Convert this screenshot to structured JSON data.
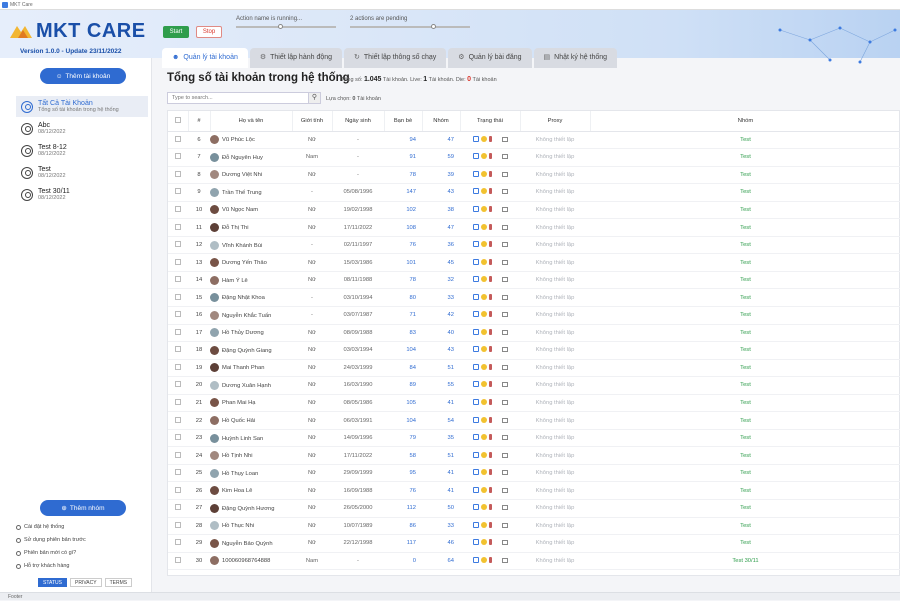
{
  "window": {
    "title": "MKT Care"
  },
  "brand": {
    "logo_text": "MKT CARE",
    "version": "Version 1.0.0 - Update 23/11/2022"
  },
  "controls": {
    "start_label": "Start",
    "stop_label": "Stop",
    "action_status": "Action name is running...",
    "pending_status": "2 actions are pending",
    "action_progress": 0.45,
    "pending_progress": 0.7
  },
  "tabs": [
    {
      "label": "Quản lý tài khoản",
      "icon": "users-icon",
      "active": true
    },
    {
      "label": "Thiết lập hành động",
      "icon": "gear-icon",
      "active": false
    },
    {
      "label": "Thiết lập thông số chạy",
      "icon": "refresh-icon",
      "active": false
    },
    {
      "label": "Quản lý bài đăng",
      "icon": "gear-icon",
      "active": false
    },
    {
      "label": "Nhật ký hệ thống",
      "icon": "log-icon",
      "active": false
    }
  ],
  "sidebar": {
    "add_account_label": "Thêm tài khoản",
    "accounts": [
      {
        "name": "Tất Cả Tài Khoản",
        "sub": "Tổng số tài khoản trong hệ thống",
        "selected": true
      },
      {
        "name": "Abc",
        "sub": "08/12/2022",
        "selected": false
      },
      {
        "name": "Test 8-12",
        "sub": "08/12/2022",
        "selected": false
      },
      {
        "name": "Test",
        "sub": "08/12/2022",
        "selected": false
      },
      {
        "name": "Test 30/11",
        "sub": "08/12/2022",
        "selected": false
      }
    ],
    "add_group_label": "Thêm nhóm",
    "links": [
      "Cài đặt hệ thống",
      "Sử dụng phiên bản trước",
      "Phiên bản mới có gì?",
      "Hỗ trợ khách hàng"
    ],
    "footer_buttons": [
      "STATUS",
      "PRIVACY",
      "TERMS"
    ]
  },
  "main": {
    "title": "Tổng số tài khoản trong hệ thống",
    "summary": {
      "total_label": "Tổng số:",
      "total": "1.045",
      "total_unit": "Tài khoản.",
      "live_label": "Live:",
      "live": "1",
      "live_unit": "Tài khoản.",
      "die_label": "Die:",
      "die": "0",
      "die_unit": "Tài khoản"
    },
    "search_placeholder": "Type to search...",
    "selection_label": "Lựa chọn:",
    "selection_count": "0",
    "selection_unit": "Tài khoản",
    "columns": [
      "#",
      "Họ và tên",
      "Giới tính",
      "Ngày sinh",
      "Bạn bè",
      "Nhóm",
      "Trạng thái",
      "Proxy",
      "Nhóm"
    ],
    "rows": [
      [
        "6",
        "Vũ Phúc Lộc",
        "Nữ",
        "-",
        "94",
        "47",
        "Không thiết lập",
        "Test"
      ],
      [
        "7",
        "Đỗ Nguyên Huy",
        "Nam",
        "-",
        "91",
        "59",
        "Không thiết lập",
        "Test"
      ],
      [
        "8",
        "Dương Việt Nhi",
        "Nữ",
        "-",
        "78",
        "39",
        "Không thiết lập",
        "Test"
      ],
      [
        "9",
        "Trần Thế Trung",
        "-",
        "05/08/1996",
        "147",
        "43",
        "Không thiết lập",
        "Test"
      ],
      [
        "10",
        "Vũ Ngọc Nam",
        "Nữ",
        "19/02/1998",
        "102",
        "38",
        "Không thiết lập",
        "Test"
      ],
      [
        "11",
        "Đỗ Thị Thi",
        "Nữ",
        "17/11/2022",
        "108",
        "47",
        "Không thiết lập",
        "Test"
      ],
      [
        "12",
        "Vĩnh Khánh Bùi",
        "-",
        "02/11/1997",
        "76",
        "36",
        "Không thiết lập",
        "Test"
      ],
      [
        "13",
        "Dương Yến Thảo",
        "Nữ",
        "15/03/1986",
        "101",
        "45",
        "Không thiết lập",
        "Test"
      ],
      [
        "14",
        "Hàm Ý Lê",
        "Nữ",
        "08/11/1988",
        "78",
        "32",
        "Không thiết lập",
        "Test"
      ],
      [
        "15",
        "Đặng Nhật Khoa",
        "-",
        "03/10/1994",
        "80",
        "33",
        "Không thiết lập",
        "Test"
      ],
      [
        "16",
        "Nguyễn Khắc Tuấn",
        "-",
        "03/07/1987",
        "71",
        "42",
        "Không thiết lập",
        "Test"
      ],
      [
        "17",
        "Hồ Thủy Dương",
        "Nữ",
        "08/09/1988",
        "83",
        "40",
        "Không thiết lập",
        "Test"
      ],
      [
        "18",
        "Đặng Quỳnh Giang",
        "Nữ",
        "03/03/1994",
        "104",
        "43",
        "Không thiết lập",
        "Test"
      ],
      [
        "19",
        "Mai Thanh Phan",
        "Nữ",
        "24/03/1999",
        "84",
        "51",
        "Không thiết lập",
        "Test"
      ],
      [
        "20",
        "Dương Xuân Hạnh",
        "Nữ",
        "16/03/1990",
        "89",
        "55",
        "Không thiết lập",
        "Test"
      ],
      [
        "21",
        "Phan Mai Hạ",
        "Nữ",
        "08/05/1986",
        "105",
        "41",
        "Không thiết lập",
        "Test"
      ],
      [
        "22",
        "Hồ Quốc Hải",
        "Nữ",
        "06/03/1991",
        "104",
        "54",
        "Không thiết lập",
        "Test"
      ],
      [
        "23",
        "Huỳnh Linh San",
        "Nữ",
        "14/09/1996",
        "79",
        "35",
        "Không thiết lập",
        "Test"
      ],
      [
        "24",
        "Hồ Tịnh Nhi",
        "Nữ",
        "17/11/2022",
        "58",
        "51",
        "Không thiết lập",
        "Test"
      ],
      [
        "25",
        "Hồ Thụy Loan",
        "Nữ",
        "29/09/1999",
        "95",
        "41",
        "Không thiết lập",
        "Test"
      ],
      [
        "26",
        "Kim Hoa Lê",
        "Nữ",
        "16/09/1988",
        "76",
        "41",
        "Không thiết lập",
        "Test"
      ],
      [
        "27",
        "Đặng Quỳnh Hương",
        "Nữ",
        "26/05/2000",
        "112",
        "50",
        "Không thiết lập",
        "Test"
      ],
      [
        "28",
        "Hồ Thục Nhi",
        "Nữ",
        "10/07/1989",
        "86",
        "33",
        "Không thiết lập",
        "Test"
      ],
      [
        "29",
        "Nguyễn Bảo Quỳnh",
        "Nữ",
        "22/12/1998",
        "117",
        "46",
        "Không thiết lập",
        "Test"
      ],
      [
        "30",
        "100060968764888",
        "Nam",
        "-",
        "0",
        "64",
        "Không thiết lập",
        "Test 30/11"
      ]
    ]
  },
  "footer": {
    "text": "Footer"
  }
}
